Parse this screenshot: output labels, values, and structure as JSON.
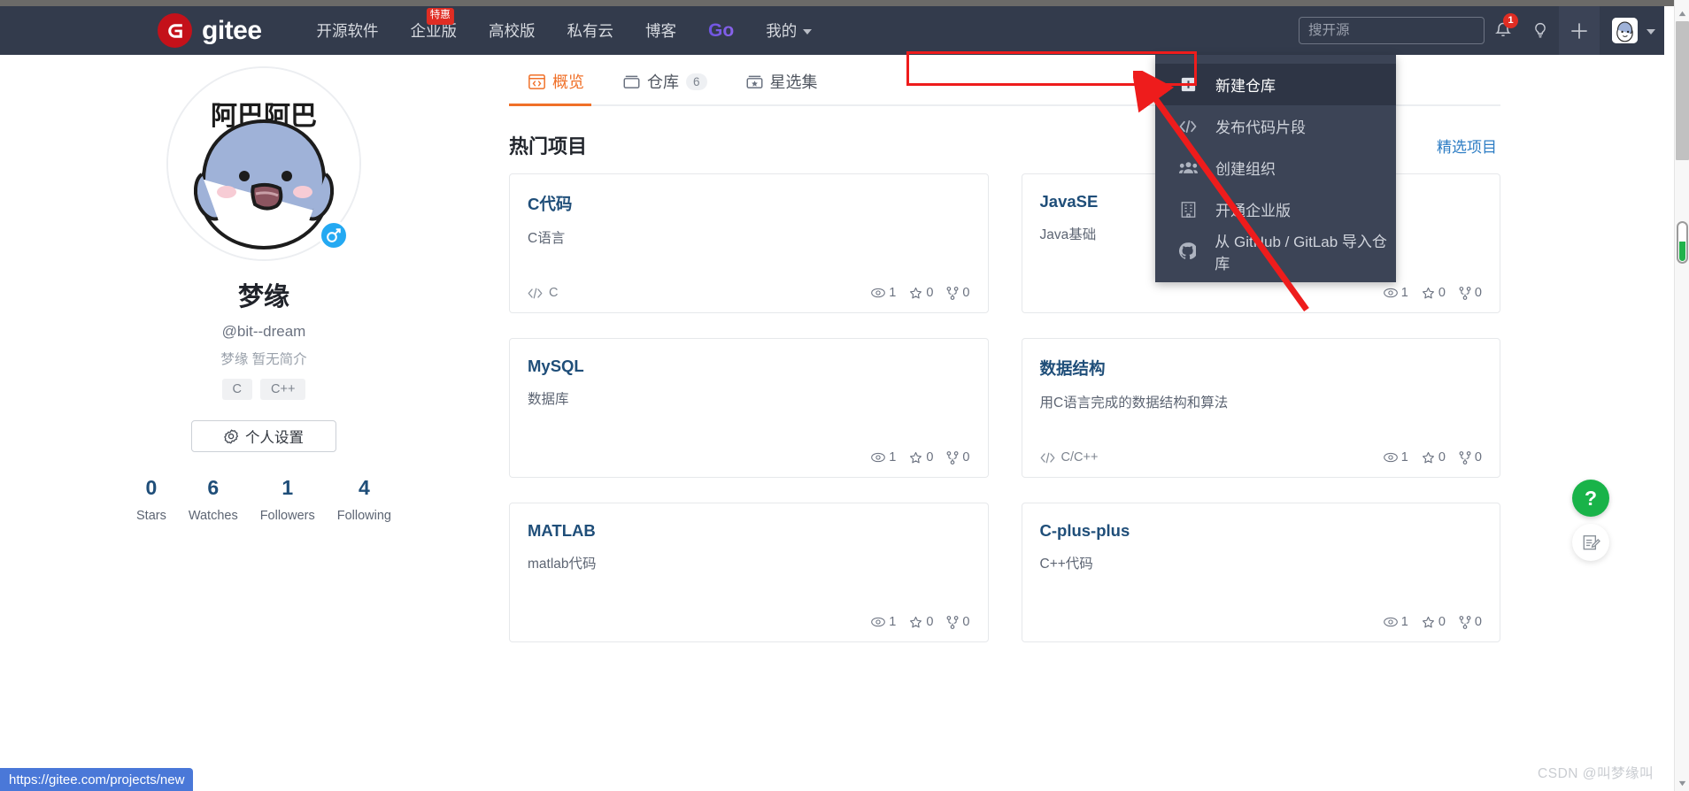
{
  "brand": {
    "logo_glyph": "G",
    "name": "gitee"
  },
  "topnav": {
    "items": [
      {
        "label": "开源软件",
        "badge": null
      },
      {
        "label": "企业版",
        "badge": "特惠"
      },
      {
        "label": "高校版",
        "badge": null
      },
      {
        "label": "私有云",
        "badge": null
      },
      {
        "label": "博客",
        "badge": null
      },
      {
        "label": "Go",
        "badge": null
      },
      {
        "label": "我的",
        "badge": null
      }
    ],
    "search": {
      "placeholder": "搜开源",
      "value": ""
    },
    "notification_count": "1"
  },
  "dropdown": {
    "items": [
      {
        "label": "新建仓库",
        "icon": "plus-square-icon",
        "active": true
      },
      {
        "label": "发布代码片段",
        "icon": "code-icon",
        "active": false
      },
      {
        "label": "创建组织",
        "icon": "people-icon",
        "active": false
      },
      {
        "label": "开通企业版",
        "icon": "building-icon",
        "active": false
      },
      {
        "label": "从 GitHub / GitLab 导入仓库",
        "icon": "github-icon",
        "active": false
      }
    ]
  },
  "profile": {
    "name": "梦缘",
    "handle": "@bit--dream",
    "bio": "梦缘 暂无简介",
    "tags": [
      "C",
      "C++"
    ],
    "settings_label": "个人设置",
    "stats": [
      {
        "value": "0",
        "label": "Stars"
      },
      {
        "value": "6",
        "label": "Watches"
      },
      {
        "value": "1",
        "label": "Followers"
      },
      {
        "value": "4",
        "label": "Following"
      }
    ]
  },
  "tabs": [
    {
      "label": "概览",
      "count": null,
      "active": true,
      "icon": "code-window-icon"
    },
    {
      "label": "仓库",
      "count": "6",
      "active": false,
      "icon": "repo-icon"
    },
    {
      "label": "星选集",
      "count": null,
      "active": false,
      "icon": "star-box-icon"
    }
  ],
  "main": {
    "section_title": "热门项目",
    "section_link": "精选项目",
    "cards": [
      {
        "title": "C代码",
        "desc": "C语言",
        "lang": "C",
        "watches": "1",
        "stars": "0",
        "forks": "0"
      },
      {
        "title": "JavaSE",
        "desc": "Java基础",
        "lang": "",
        "watches": "1",
        "stars": "0",
        "forks": "0"
      },
      {
        "title": "MySQL",
        "desc": "数据库",
        "lang": "",
        "watches": "1",
        "stars": "0",
        "forks": "0"
      },
      {
        "title": "数据结构",
        "desc": "用C语言完成的数据结构和算法",
        "lang": "C/C++",
        "watches": "1",
        "stars": "0",
        "forks": "0"
      },
      {
        "title": "MATLAB",
        "desc": "matlab代码",
        "lang": "",
        "watches": "1",
        "stars": "0",
        "forks": "0"
      },
      {
        "title": "C-plus-plus",
        "desc": "C++代码",
        "lang": "",
        "watches": "1",
        "stars": "0",
        "forks": "0"
      }
    ]
  },
  "floating": {
    "help_label": "?",
    "feedback_icon": "feedback-pencil-icon"
  },
  "statusbar": {
    "url": "https://gitee.com/projects/new"
  },
  "watermark": {
    "text": "CSDN @叫梦缘叫"
  },
  "colors": {
    "nav_bg": "#333b4c",
    "dropdown_bg": "#3c4456",
    "accent_orange": "#f07028",
    "link_blue": "#1f4e79",
    "annotation_red": "#ee1c1c",
    "help_green": "#19b349",
    "brand_red": "#c4111a"
  }
}
